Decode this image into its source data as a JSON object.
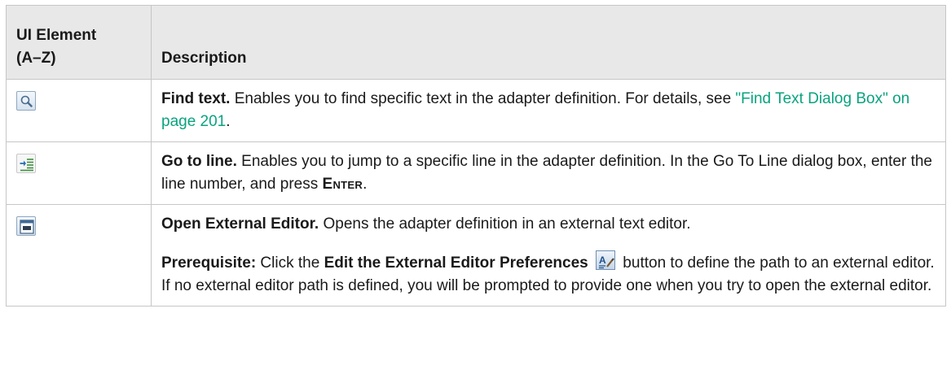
{
  "table": {
    "header": {
      "col1_line1": "UI Element",
      "col1_line2": "(A–Z)",
      "col2": "Description"
    },
    "rows": [
      {
        "icon": "find-text-icon",
        "title": "Find text.",
        "text": " Enables you to find specific text in the adapter definition. For details, see ",
        "link": "\"Find Text Dialog Box\" on page 201",
        "after_link": "."
      },
      {
        "icon": "go-to-line-icon",
        "title": "Go to line.",
        "text": " Enables you to jump to a specific line in the adapter definition. In the Go To Line dialog box, enter the line number, and press ",
        "key": "Enter",
        "after_key": "."
      },
      {
        "icon": "open-external-editor-icon",
        "title": "Open External Editor.",
        "text": " Opens the adapter definition in an external text editor.",
        "prereq_label": "Prerequisite:",
        "prereq_text1": " Click the ",
        "prereq_button": "Edit the External Editor Preferences",
        "prereq_button_icon": "edit-preferences-icon",
        "prereq_text2": " button to define the path to an external editor. If no external editor path is defined, you will be prompted to provide one when you try to open the external editor."
      }
    ]
  },
  "colors": {
    "header_bg": "#e8e8e8",
    "border": "#c6c6c6",
    "link": "#0aa37f"
  }
}
